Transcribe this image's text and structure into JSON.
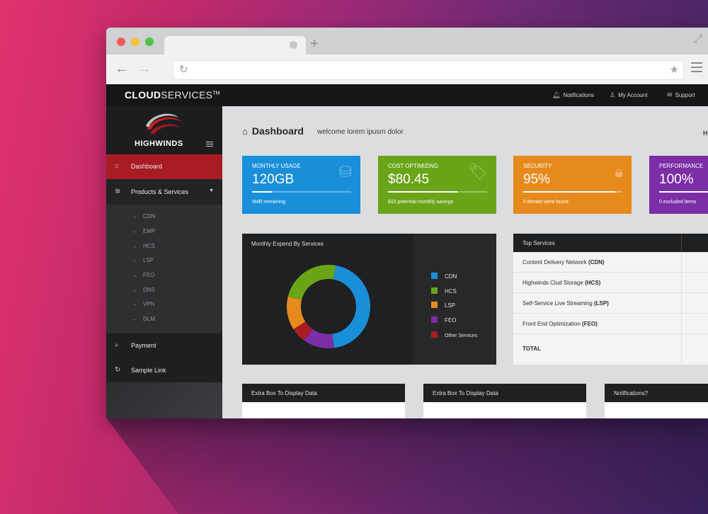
{
  "browser": {
    "new_tab_label": "+"
  },
  "header": {
    "brand_bold": "CLOUD",
    "brand_light": "SERVICES",
    "brand_tm": "TM",
    "links": [
      {
        "label": "Notifications",
        "icon": "bell-icon"
      },
      {
        "label": "My Account",
        "icon": "user-icon"
      },
      {
        "label": "Support",
        "icon": "mail-icon"
      }
    ]
  },
  "sidebar": {
    "logo_text": "HIGHWINDS",
    "items": [
      {
        "label": "Dashboard",
        "icon": "home-icon",
        "active": true
      },
      {
        "label": "Products & Services",
        "icon": "layers-icon"
      },
      {
        "label": "Payment",
        "icon": "tag-icon"
      },
      {
        "label": "Sample Link",
        "icon": "refresh-icon"
      }
    ],
    "sub_items": [
      "CDN",
      "EMP",
      "HCS",
      "LSP",
      "FEO",
      "DNS",
      "VPN",
      "DLM"
    ]
  },
  "page": {
    "title": "Dashboard",
    "subtitle": "welcome lorem ipusm dolor",
    "right_text": "H"
  },
  "stats": [
    {
      "label": "MONTHLY USAGE",
      "value": "120GB",
      "note": "5MB remaining",
      "color": "#1a8fd9",
      "progress": 0.2,
      "icon": "database-icon"
    },
    {
      "label": "COST OPTIMIZING",
      "value": "$80.45",
      "note": "$10 potential monthly savings",
      "color": "#6aa519",
      "progress": 0.7,
      "icon": "price-tag-icon"
    },
    {
      "label": "SECURITY",
      "value": "95%",
      "note": "5 threats were found",
      "color": "#e68a1d",
      "progress": 0.93,
      "icon": "lock-icon"
    },
    {
      "label": "PERFORMANCE",
      "value": "100%",
      "note": "0 excluded items",
      "color": "#7b2ea6",
      "progress": 1.0,
      "icon": "gauge-icon"
    }
  ],
  "chart": {
    "title": "Monthly Expend By Services",
    "legend": [
      {
        "label": "CDN",
        "color": "#1a8fd9"
      },
      {
        "label": "HCS",
        "color": "#6aa519"
      },
      {
        "label": "LSP",
        "color": "#e68a1d"
      },
      {
        "label": "FEO",
        "color": "#7b2ea6"
      },
      {
        "label": "Other Services",
        "color": "#a81c24"
      }
    ]
  },
  "chart_data": {
    "type": "pie",
    "title": "Monthly Expend By Services",
    "categories": [
      "CDN",
      "FEO",
      "Other Services",
      "LSP",
      "HCS"
    ],
    "values": [
      45,
      12,
      6,
      13,
      24
    ],
    "colors": [
      "#1a8fd9",
      "#7b2ea6",
      "#a81c24",
      "#e68a1d",
      "#6aa519"
    ]
  },
  "table": {
    "header": "Top Services",
    "rows": [
      {
        "text": "Content Delivery Network",
        "abbr": "(CDN)"
      },
      {
        "text": "Highwinds Clud Storage",
        "abbr": "(HCS)"
      },
      {
        "text": "Self-Service Live Streaming",
        "abbr": "(LSP)"
      },
      {
        "text": "Front End Optimization",
        "abbr": "(FEO)"
      }
    ],
    "total_label": "TOTAL"
  },
  "extra_boxes": [
    "Extra Box To Display Data",
    "Extra Box To Display Data",
    "Notifications?"
  ]
}
